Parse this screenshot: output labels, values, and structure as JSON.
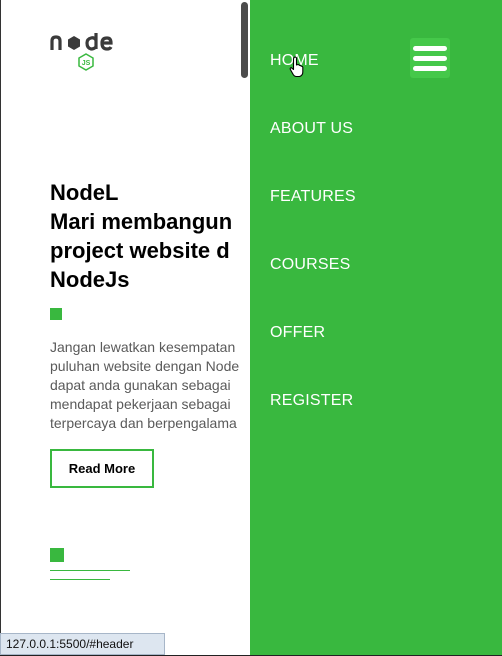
{
  "logo": {
    "text": "node",
    "badge": "JS"
  },
  "hero": {
    "title_lines": [
      "NodeL",
      "Mari membangun",
      "project website d",
      "NodeJs"
    ],
    "description_lines": [
      "Jangan lewatkan kesempatan",
      "puluhan website dengan Node",
      "dapat anda gunakan sebagai",
      "mendapat pekerjaan sebagai",
      "terpercaya dan berpengalama"
    ],
    "read_more_label": "Read More"
  },
  "nav": {
    "items": [
      {
        "label": "HOME"
      },
      {
        "label": "ABOUT US"
      },
      {
        "label": "FEATURES"
      },
      {
        "label": "COURSES"
      },
      {
        "label": "OFFER"
      },
      {
        "label": "REGISTER"
      }
    ],
    "menu_icon": "hamburger-icon"
  },
  "status_bar": {
    "url": "127.0.0.1:5500/#header"
  },
  "colors": {
    "accent": "#39b83f",
    "panel": "#39b83f",
    "text_muted": "#5a5a5a"
  }
}
